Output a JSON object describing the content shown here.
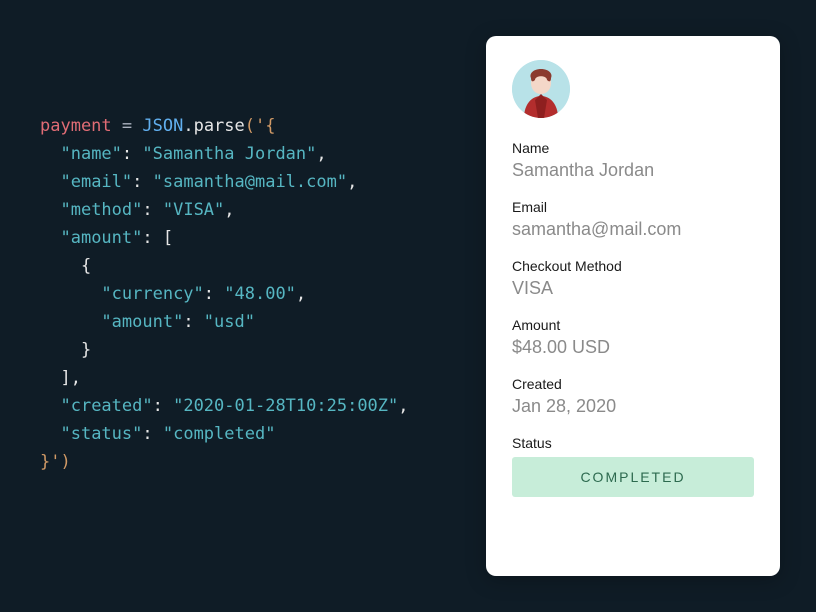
{
  "code": {
    "var_name": "payment",
    "json_class": "JSON",
    "parse_fn": "parse",
    "open": "('{",
    "line_name_key": "\"name\"",
    "line_name_val": "\"Samantha Jordan\"",
    "line_email_key": "\"email\"",
    "line_email_val": "\"samantha@mail.com\"",
    "line_method_key": "\"method\"",
    "line_method_val": "\"VISA\"",
    "line_amount_key": "\"amount\"",
    "line_currency_key": "\"currency\"",
    "line_currency_val": "\"48.00\"",
    "line_amount_inner_key": "\"amount\"",
    "line_amount_inner_val": "\"usd\"",
    "line_created_key": "\"created\"",
    "line_created_val": "\"2020-01-28T10:25:00Z\"",
    "line_status_key": "\"status\"",
    "line_status_val": "\"completed\"",
    "close": "}')"
  },
  "card": {
    "name_label": "Name",
    "name_value": "Samantha Jordan",
    "email_label": "Email",
    "email_value": "samantha@mail.com",
    "method_label": "Checkout Method",
    "method_value": "VISA",
    "amount_label": "Amount",
    "amount_value": "$48.00 USD",
    "created_label": "Created",
    "created_value": "Jan 28, 2020",
    "status_label": "Status",
    "status_value": "COMPLETED"
  }
}
